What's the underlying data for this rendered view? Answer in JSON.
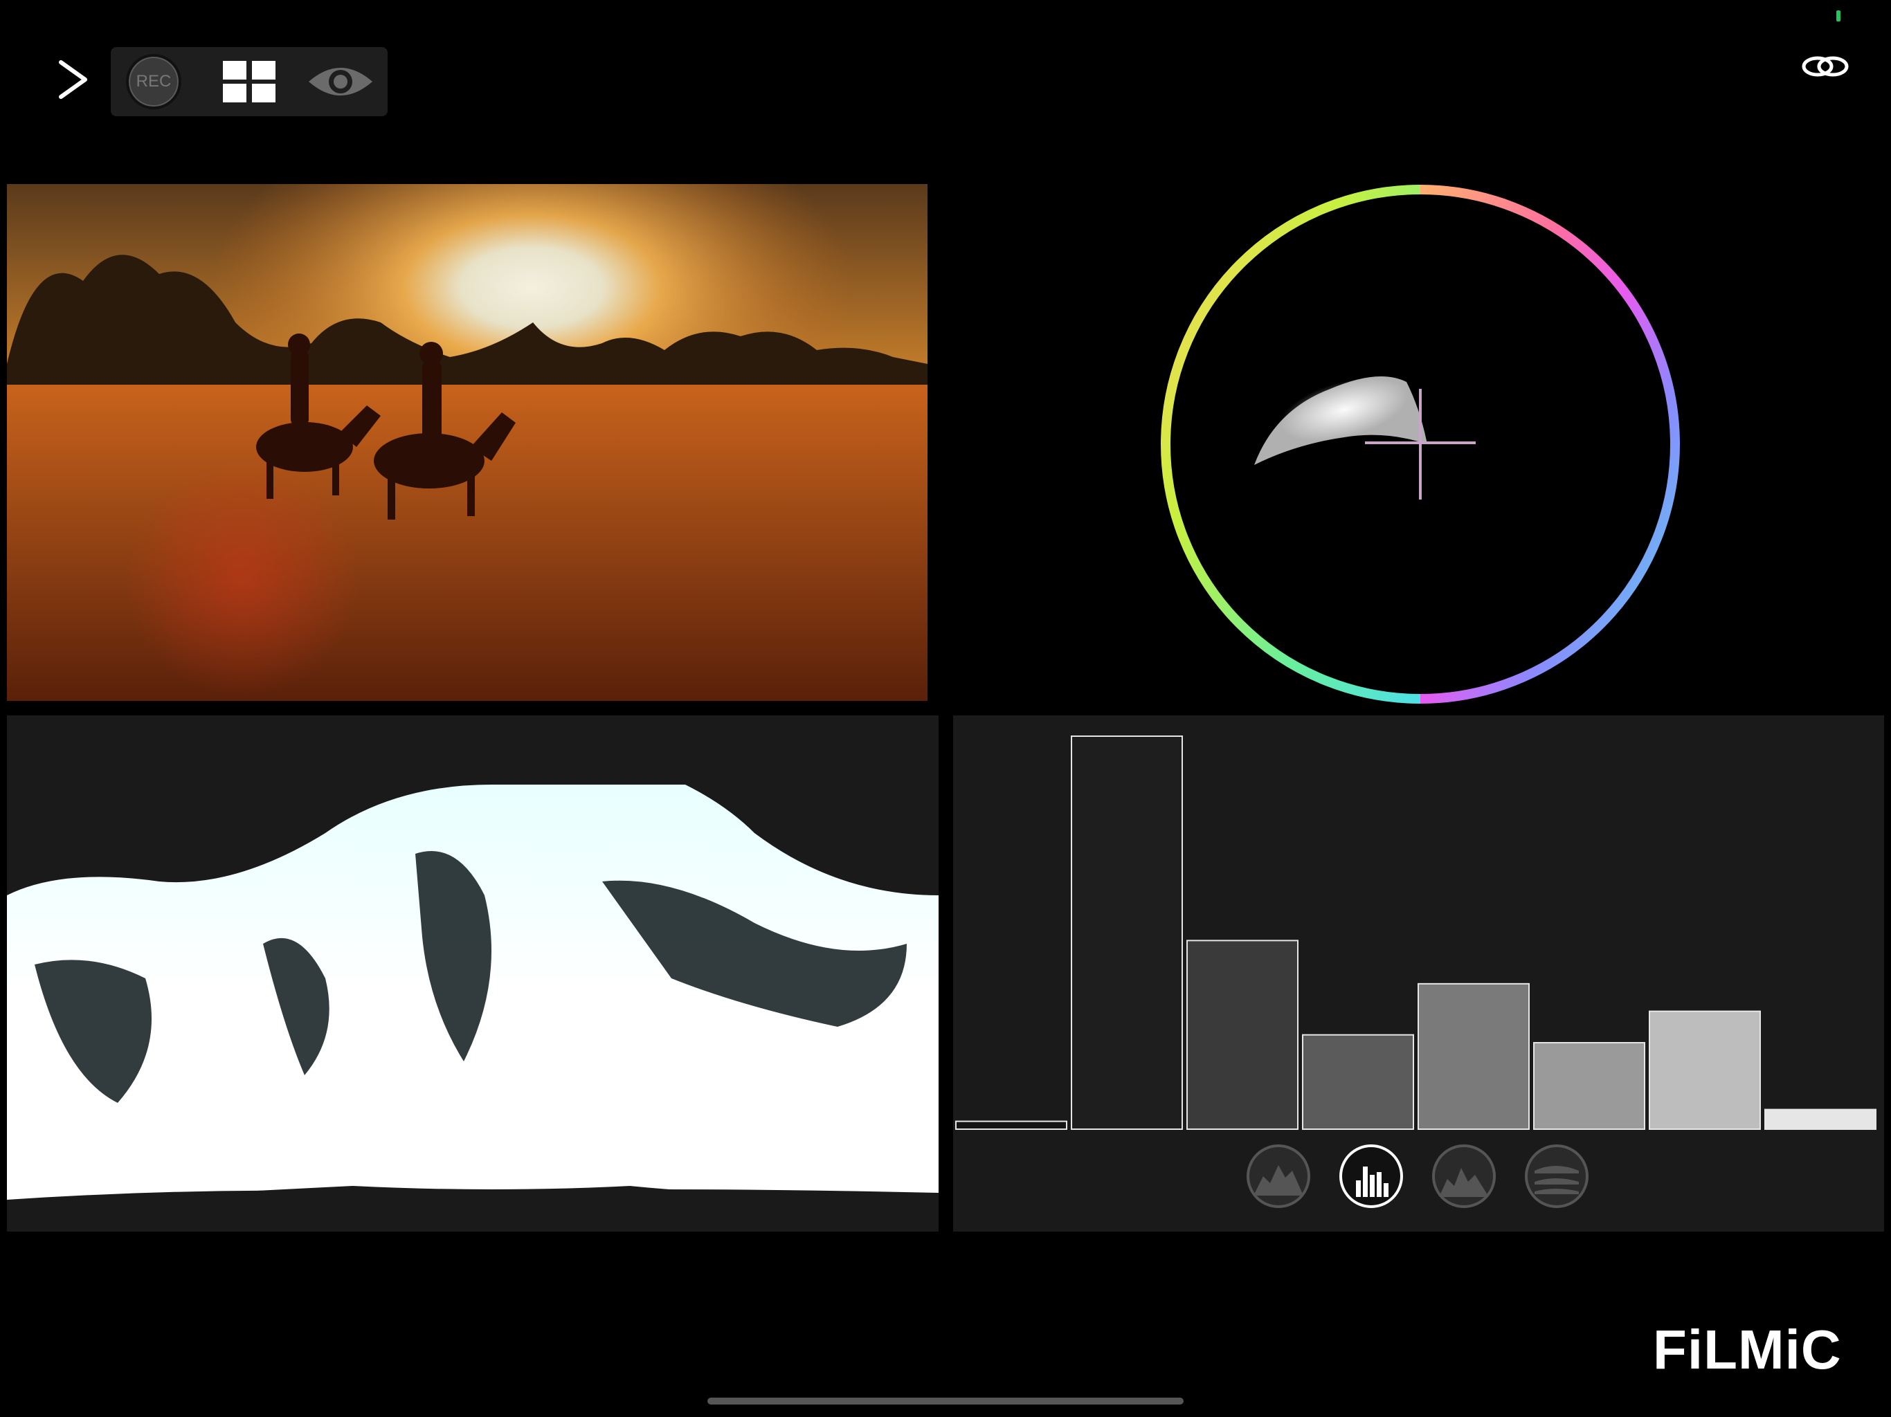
{
  "toolbar": {
    "rec_label": "REC",
    "chevron_icon": "chevron-right-icon",
    "grid_icon": "quad-grid-icon",
    "eye_icon": "eye-icon"
  },
  "status": {
    "link_icon": "linked-rings-icon",
    "battery_color": "#22c55e"
  },
  "preview": {
    "description_icon": "camera-preview-image"
  },
  "vectorscope": {
    "ring_colors": [
      "#ff6fa0",
      "#e85bf0",
      "#8a8aff",
      "#4fe0e6",
      "#6af09a",
      "#f6f23a",
      "#ffd35a"
    ]
  },
  "histogram": {
    "bars": [
      0.02,
      1.0,
      0.48,
      0.24,
      0.37,
      0.22,
      0.3,
      0.05
    ],
    "bar_shades": [
      "#151515",
      "#1e1e1e",
      "#3a3a3a",
      "#5b5b5b",
      "#7a7a7a",
      "#9a9a9a",
      "#bdbdbd",
      "#e6e6e6"
    ],
    "modes": [
      {
        "name": "luma-histogram-icon",
        "active": false
      },
      {
        "name": "bar-histogram-icon",
        "active": true
      },
      {
        "name": "rgb-histogram-icon",
        "active": false
      },
      {
        "name": "layered-histogram-icon",
        "active": false
      }
    ]
  },
  "brand": {
    "text": "FiLMiC"
  }
}
